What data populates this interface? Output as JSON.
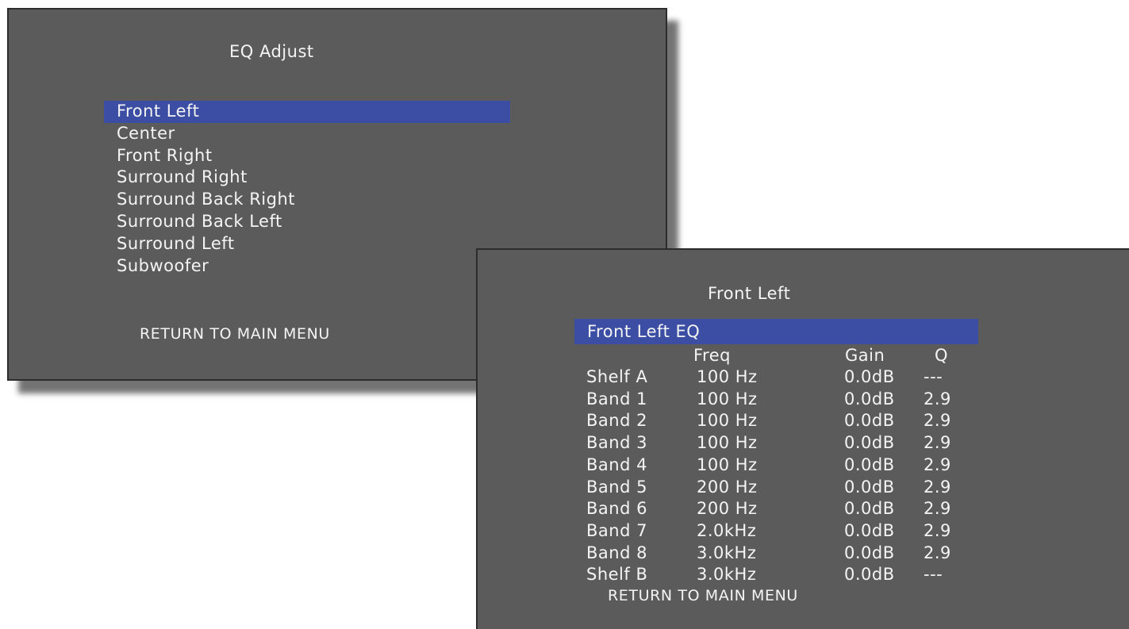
{
  "eq_adjust": {
    "title": "EQ Adjust",
    "channels": [
      "Front Left",
      "Center",
      "Front Right",
      "Surround Right",
      "Surround Back Right",
      "Surround Back Left",
      "Surround Left",
      "Subwoofer"
    ],
    "selected": "Front Left",
    "return_label": "RETURN TO MAIN MENU"
  },
  "front_left": {
    "title": "Front Left",
    "selected_row": "Front Left EQ",
    "columns": {
      "freq": "Freq",
      "gain": "Gain",
      "q": "Q"
    },
    "bands": [
      {
        "name": "Shelf A",
        "freq": "100 Hz",
        "gain": "0.0dB",
        "q": "---"
      },
      {
        "name": "Band 1",
        "freq": "100 Hz",
        "gain": "0.0dB",
        "q": "2.9"
      },
      {
        "name": "Band 2",
        "freq": "100 Hz",
        "gain": "0.0dB",
        "q": "2.9"
      },
      {
        "name": "Band 3",
        "freq": "100 Hz",
        "gain": "0.0dB",
        "q": "2.9"
      },
      {
        "name": "Band 4",
        "freq": "100 Hz",
        "gain": "0.0dB",
        "q": "2.9"
      },
      {
        "name": "Band 5",
        "freq": "200 Hz",
        "gain": "0.0dB",
        "q": "2.9"
      },
      {
        "name": "Band 6",
        "freq": "200 Hz",
        "gain": "0.0dB",
        "q": "2.9"
      },
      {
        "name": "Band 7",
        "freq": "2.0kHz",
        "gain": "0.0dB",
        "q": "2.9"
      },
      {
        "name": "Band 8",
        "freq": "3.0kHz",
        "gain": "0.0dB",
        "q": "2.9"
      },
      {
        "name": "Shelf B",
        "freq": "3.0kHz",
        "gain": "0.0dB",
        "q": "---"
      }
    ],
    "return_label": "RETURN TO MAIN MENU"
  },
  "colors": {
    "panel_bg": "#5b5b5b",
    "highlight": "#3c4ea3",
    "text": "#f4f4f4"
  }
}
